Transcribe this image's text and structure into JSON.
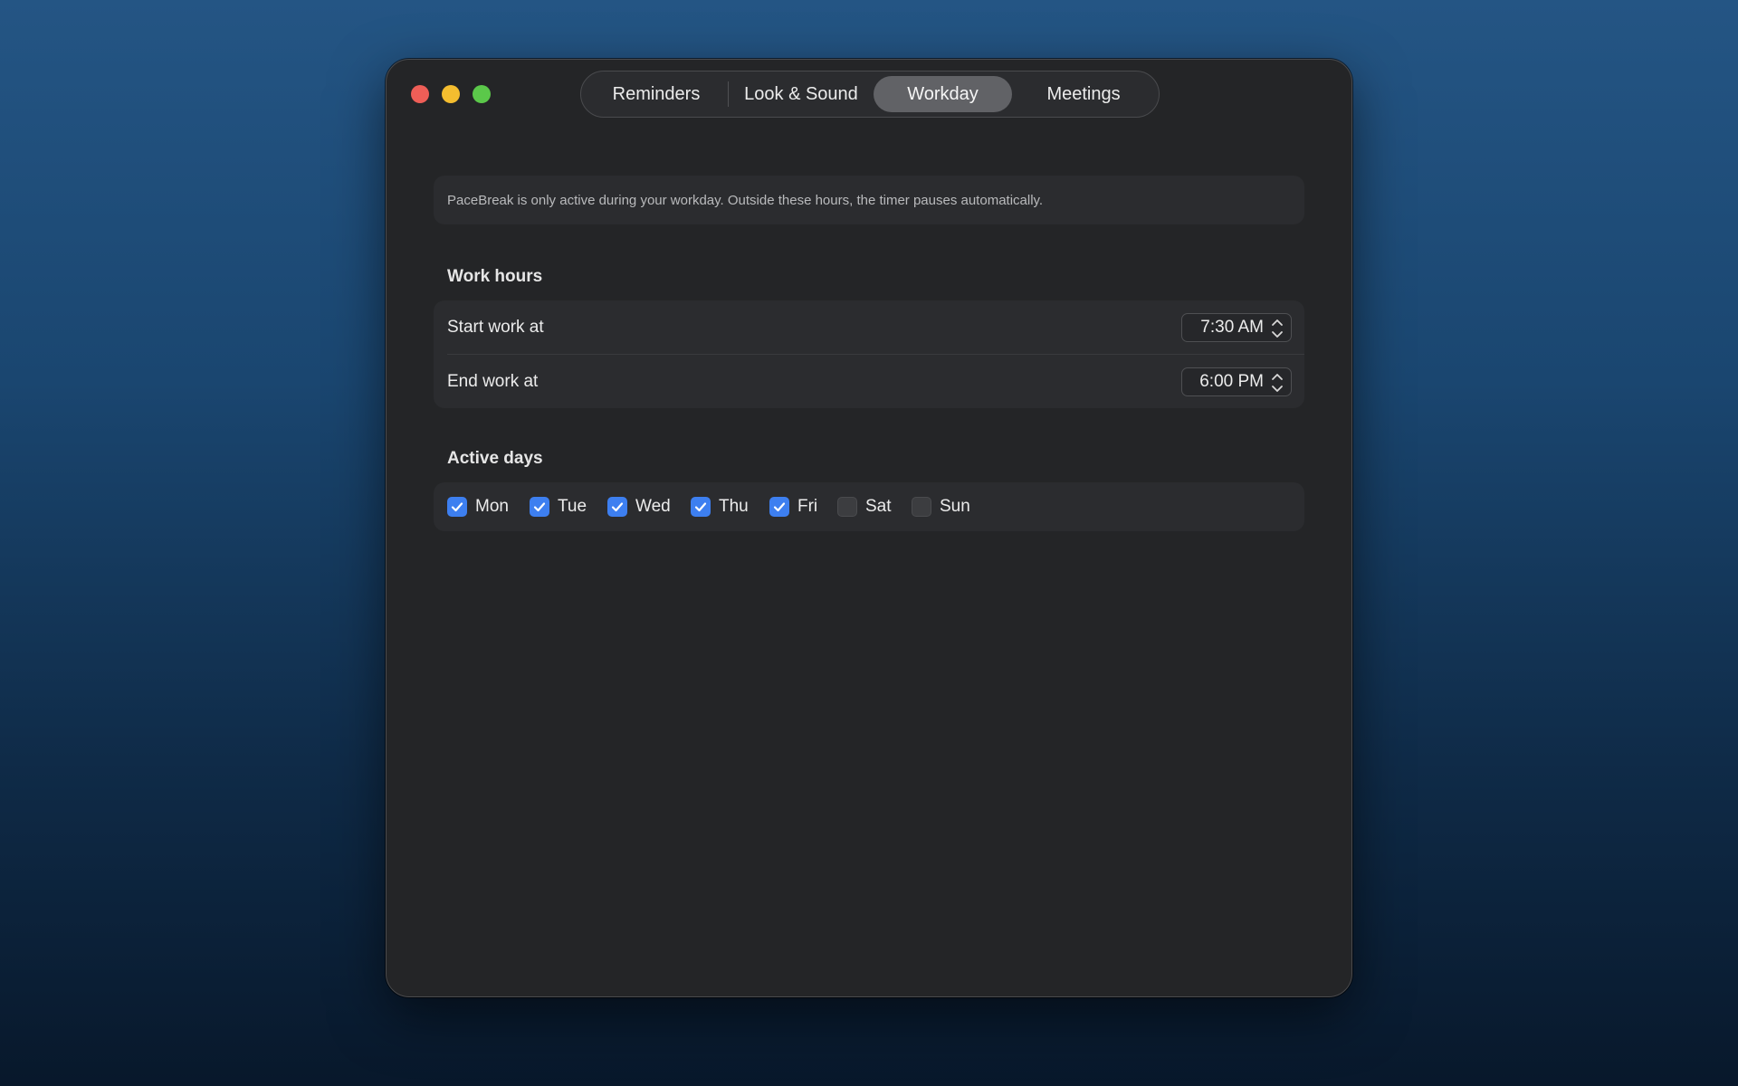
{
  "window": {
    "tabs": [
      {
        "label": "Reminders",
        "active": false
      },
      {
        "label": "Look & Sound",
        "active": false
      },
      {
        "label": "Workday",
        "active": true
      },
      {
        "label": "Meetings",
        "active": false
      }
    ],
    "info_text": "PaceBreak is only active during your workday. Outside these hours, the timer pauses automatically."
  },
  "work_hours": {
    "title": "Work hours",
    "start_label": "Start work at",
    "start_value": "7:30 AM",
    "end_label": "End work at",
    "end_value": "6:00 PM"
  },
  "active_days": {
    "title": "Active days",
    "days": [
      {
        "label": "Mon",
        "checked": true
      },
      {
        "label": "Tue",
        "checked": true
      },
      {
        "label": "Wed",
        "checked": true
      },
      {
        "label": "Thu",
        "checked": true
      },
      {
        "label": "Fri",
        "checked": true
      },
      {
        "label": "Sat",
        "checked": false
      },
      {
        "label": "Sun",
        "checked": false
      }
    ]
  },
  "colors": {
    "accent": "#3d7ff0",
    "window_bg": "#242527",
    "close": "#ee5e57",
    "minimize": "#f4bd2f",
    "maximize": "#5bc84a"
  }
}
